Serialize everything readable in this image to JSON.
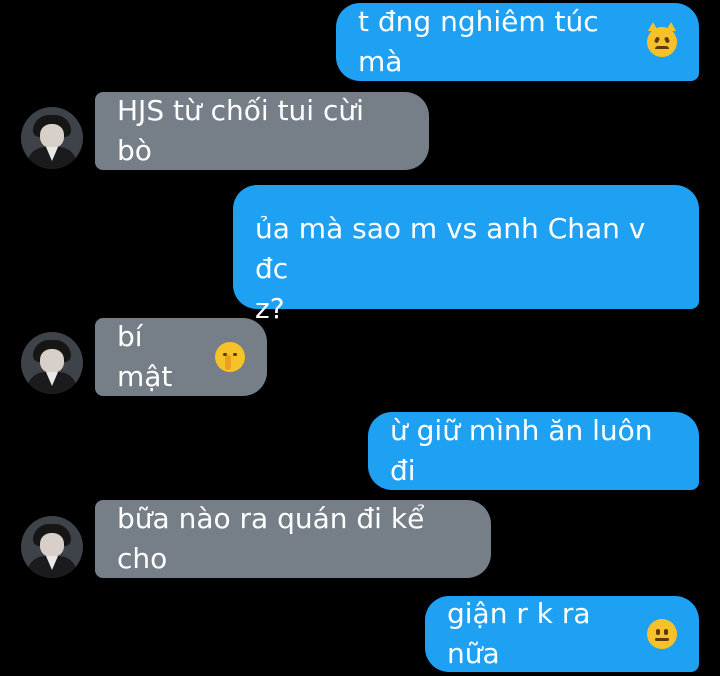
{
  "messages": [
    {
      "id": 1,
      "side": "out",
      "text": "t đng nghiêm túc mà",
      "emoji": "pouting-cat-emoji"
    },
    {
      "id": 2,
      "side": "in",
      "text": "HJS từ chối tui cừi bò"
    },
    {
      "id": 3,
      "side": "out",
      "line1": "ủa mà sao m vs anh Chan v đc",
      "line2": "z?"
    },
    {
      "id": 4,
      "side": "in",
      "text": "bí mật",
      "emoji": "shushing-face-emoji"
    },
    {
      "id": 5,
      "side": "out",
      "text": "ừ giữ mình ăn luôn đi"
    },
    {
      "id": 6,
      "side": "in",
      "text": "bữa nào ra quán đi kể cho"
    },
    {
      "id": 7,
      "side": "out",
      "text": "giận r k ra nữa",
      "emoji": "neutral-face-emoji"
    }
  ],
  "colors": {
    "background": "#000000",
    "outgoing_bubble": "#1ea0f3",
    "incoming_bubble": "#767f88",
    "text": "#ffffff"
  },
  "icons": {
    "avatar": "contact-avatar"
  }
}
